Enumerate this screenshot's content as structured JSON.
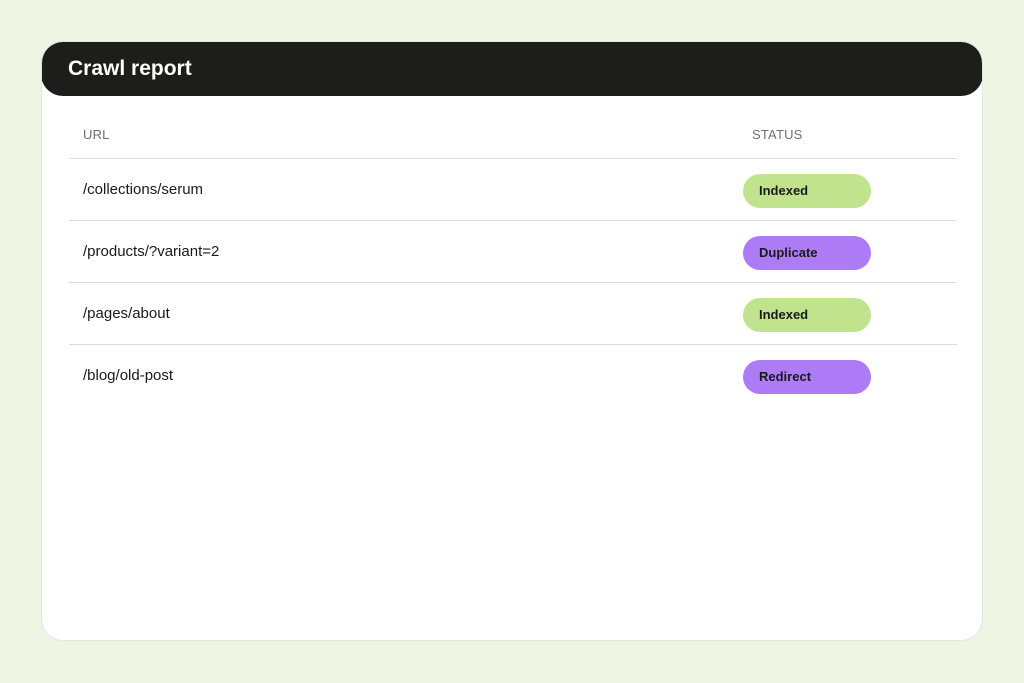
{
  "report": {
    "title": "Crawl report",
    "columns": {
      "url": "URL",
      "status": "STATUS"
    },
    "rows": [
      {
        "url": "/collections/serum",
        "status": "Indexed",
        "color": "#c1e38d"
      },
      {
        "url": "/products/?variant=2",
        "status": "Duplicate",
        "color": "#ad7bf6"
      },
      {
        "url": "/pages/about",
        "status": "Indexed",
        "color": "#c1e38d"
      },
      {
        "url": "/blog/old-post",
        "status": "Redirect",
        "color": "#ad7bf6"
      }
    ]
  }
}
